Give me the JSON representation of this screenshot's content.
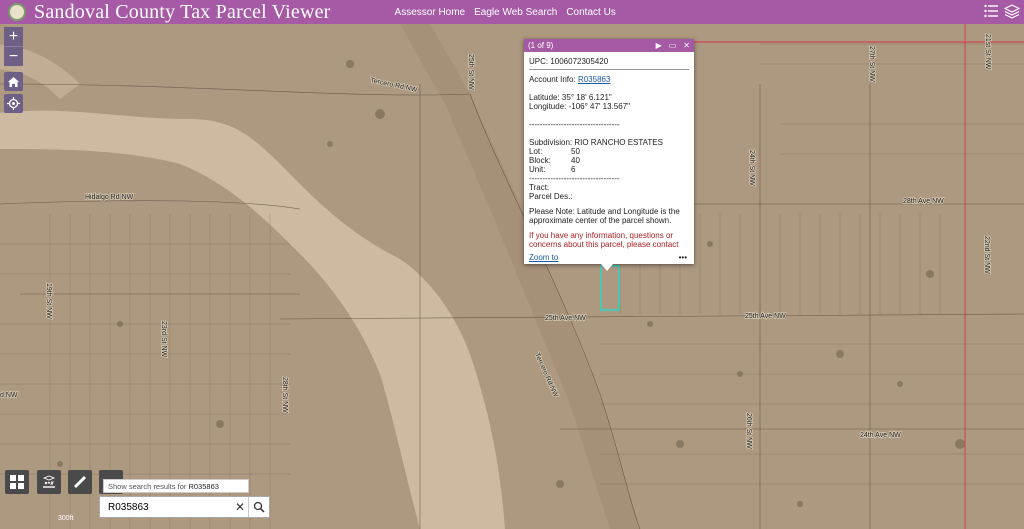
{
  "header": {
    "title": "Sandoval County Tax Parcel Viewer",
    "nav": [
      "Assessor Home",
      "Eagle Web Search",
      "Contact Us"
    ]
  },
  "map": {
    "streets": [
      "Tercero Rd NW",
      "Hidalgo Rd NW",
      "25th Ave NW",
      "25th Ave NW",
      "24th Ave NW",
      "28th Ave NW",
      "Tercero Rd NW",
      "28th St NW",
      "24th St NW",
      "27th St NW",
      "26th St NW",
      "21st St NW",
      "19th St NW",
      "23rd St NW",
      "22nd St NW",
      "25th St NW",
      "d NW"
    ],
    "scale_label": "300ft"
  },
  "popup": {
    "count": "(1 of 9)",
    "upc": "UPC: 1006072305420",
    "account_label": "Account Info:",
    "account_link": "R035863",
    "latitude": "Latitude: 35° 18' 6.121\"",
    "longitude": "Longitude: -106° 47' 13.567\"",
    "divider": "----------------------------------",
    "subdivision": "Subdivision: RIO RANCHO ESTATES",
    "lot_label": "Lot:",
    "lot_value": "50",
    "block_label": "Block:",
    "block_value": "40",
    "unit_label": "Unit:",
    "unit_value": "6",
    "tract": "Tract:",
    "parcel_des": "Parcel Des.:",
    "note": "Please Note: Latitude and Longitude is the approximate center of the parcel shown.",
    "contact": "If you have any information, questions or concerns about this parcel, please contact",
    "zoom_to": "Zoom to",
    "more": "•••"
  },
  "search": {
    "hint_prefix": "Show search results for",
    "hint_value": "R035863",
    "value": "R035863"
  },
  "colors": {
    "accent": "#a65aa6",
    "parcel_outline": "#2fd6c8",
    "boundary": "#e0304a"
  }
}
